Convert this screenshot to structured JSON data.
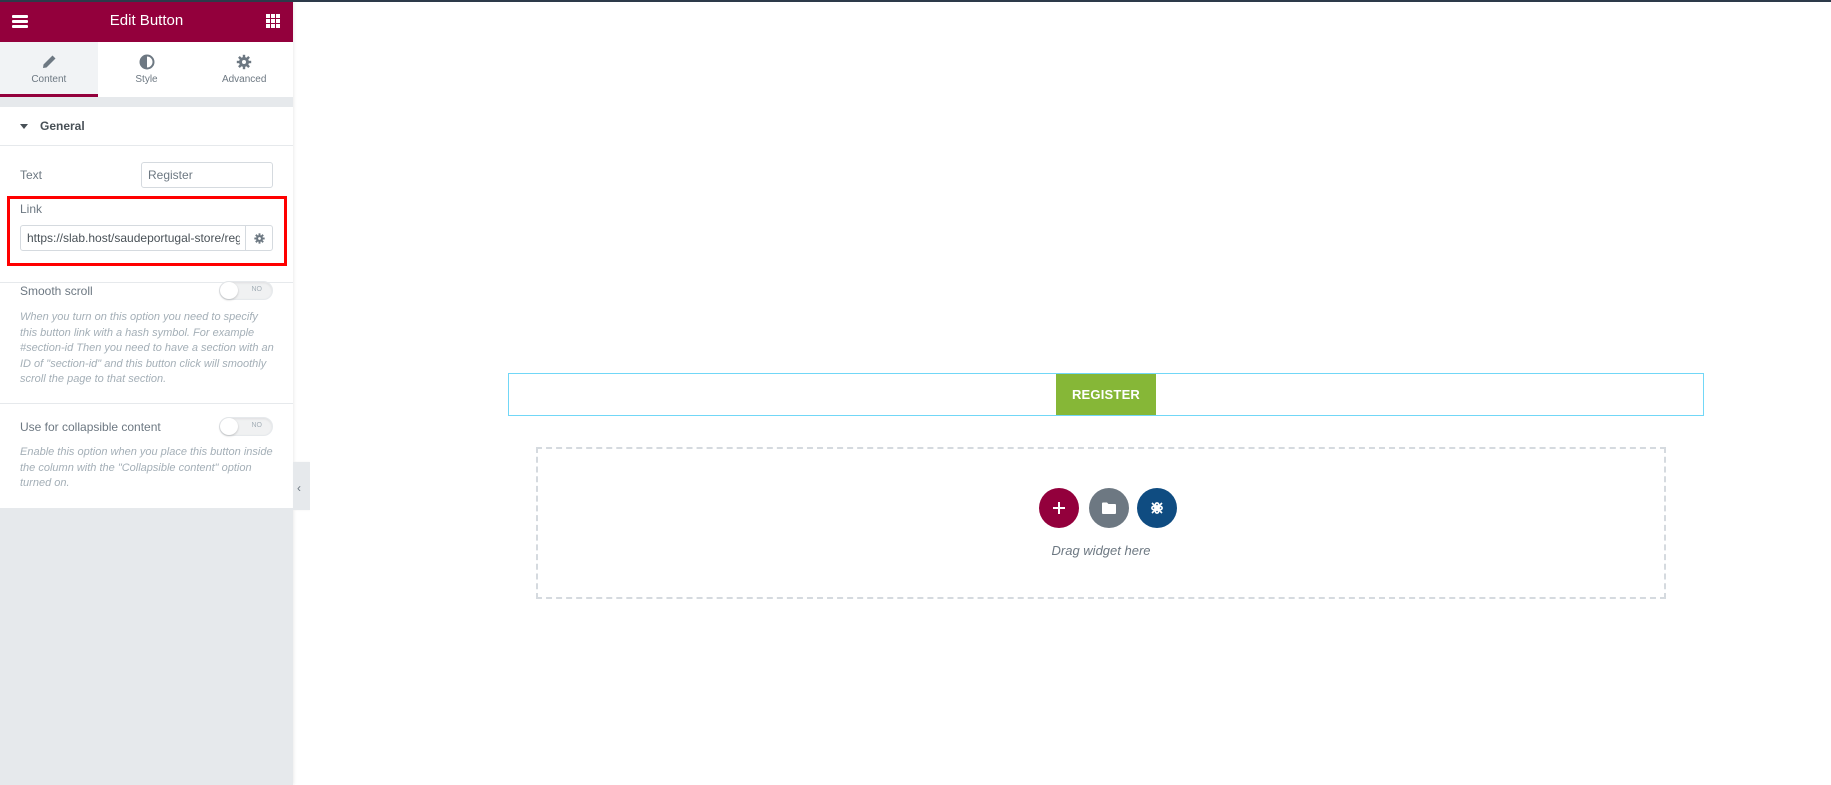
{
  "panel": {
    "header": {
      "title": "Edit Button",
      "menu_icon": "hamburger-icon",
      "widgets_icon": "grid-icon"
    },
    "tabs": [
      {
        "label": "Content",
        "icon": "pencil-icon",
        "active": true
      },
      {
        "label": "Style",
        "icon": "half-circle-icon",
        "active": false
      },
      {
        "label": "Advanced",
        "icon": "gear-icon",
        "active": false
      }
    ],
    "section": {
      "title": "General",
      "fields": {
        "text": {
          "label": "Text",
          "value": "Register"
        },
        "link": {
          "label": "Link",
          "value": "https://slab.host/saudeportugal-store/reg",
          "settings_icon": "gear-icon"
        },
        "smooth_scroll": {
          "label": "Smooth scroll",
          "toggle_label": "NO",
          "on": false,
          "description": "When you turn on this option you need to specify this button link with a hash symbol. For example #section-id Then you need to have a section with an ID of \"section-id\" and this button click will smoothly scroll the page to that section."
        },
        "collapsible": {
          "label": "Use for collapsible content",
          "toggle_label": "NO",
          "on": false,
          "description": "Enable this option when you place this button inside the column with the \"Collapsible content\" option turned on."
        }
      }
    },
    "collapse_handle_icon": "chevron-left-icon"
  },
  "canvas": {
    "register_button": {
      "label": "REGISTER"
    },
    "dropzone": {
      "text": "Drag widget here",
      "buttons": [
        {
          "name": "add-section",
          "icon": "plus-icon"
        },
        {
          "name": "add-template",
          "icon": "folder-icon"
        },
        {
          "name": "elements-kit",
          "icon": "elementskit-icon"
        }
      ]
    }
  },
  "colors": {
    "brand": "#93003c",
    "register_button": "#86b737",
    "section_outline": "#71d7f7",
    "template_circle": "#6d7882",
    "elements_circle": "#0f4c81",
    "highlight": "#ff0000"
  }
}
